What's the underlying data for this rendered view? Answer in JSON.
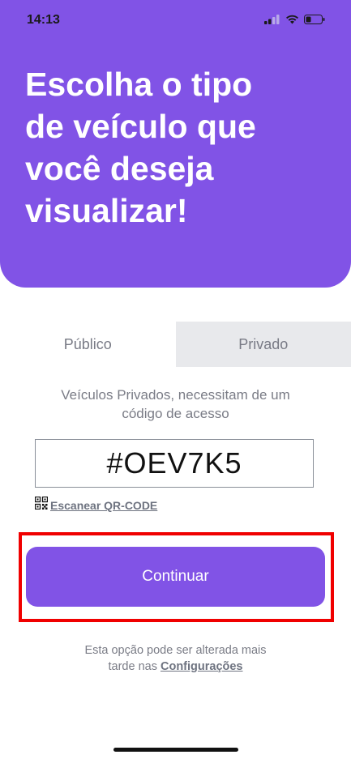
{
  "status_bar": {
    "time": "14:13",
    "icons": [
      "cellular-signal-icon",
      "wifi-icon",
      "battery-icon"
    ]
  },
  "header": {
    "title_lines": [
      "Escolha o tipo",
      "de veículo que",
      "você deseja",
      "visualizar!"
    ],
    "background_color": "#8153E6"
  },
  "tabs": [
    {
      "label": "Público",
      "active": true
    },
    {
      "label": "Privado",
      "active": false
    }
  ],
  "hint": {
    "line1": "Veículos Privados, necessitam de um",
    "line2": "código de acesso"
  },
  "code_field": {
    "value": "#OEV7K5"
  },
  "qr_link": {
    "label": "Escanear QR-CODE",
    "icon": "qr-code-icon"
  },
  "continue_button": {
    "label": "Continuar"
  },
  "footer": {
    "line1": "Esta opção pode ser alterada mais",
    "line2_prefix": "tarde nas ",
    "link": "Configurações"
  },
  "colors": {
    "accent": "#8153E6",
    "highlight": "#F00000"
  }
}
